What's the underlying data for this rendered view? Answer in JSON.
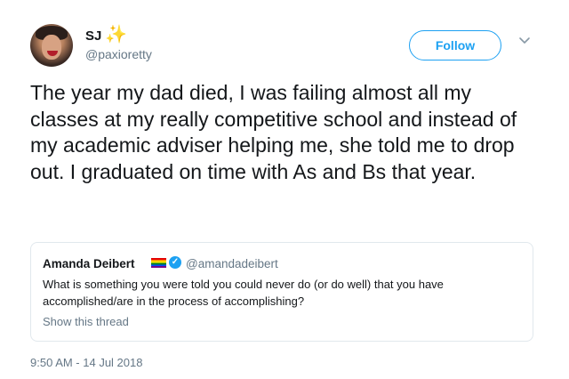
{
  "author": {
    "display_name": "SJ",
    "emoji": "✨",
    "handle": "@paxioretty"
  },
  "follow_button": {
    "label": "Follow"
  },
  "tweet": {
    "text": "The year my dad died, I was failing almost all my classes at my really competitive school and instead of my academic adviser helping me, she told me to drop out. I graduated on time with As and Bs that year.",
    "timestamp": "9:50 AM - 14 Jul 2018"
  },
  "quoted_tweet": {
    "author_name": "Amanda Deibert",
    "verified_mark": "✓",
    "author_handle": "@amandadeibert",
    "text": "What is something you were told you could never do (or do well) that you have accomplished/are in the process of accomplishing?",
    "show_thread_label": "Show this thread"
  },
  "icons": {
    "avatar": "avatar-photo",
    "caret": "chevron-down-icon",
    "flag": "rainbow-flag-icon",
    "verified": "verified-badge-icon"
  },
  "colors": {
    "accent": "#1da1f2",
    "text": "#14171a",
    "secondary": "#657786",
    "border": "#e1e8ed"
  }
}
